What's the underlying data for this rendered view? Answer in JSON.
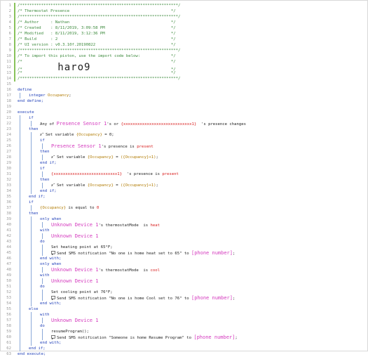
{
  "code_lines": [
    {
      "n": "1",
      "d": 0,
      "bar": true,
      "s": [
        {
          "t": "/*******************************************************************/",
          "c": "cm"
        }
      ]
    },
    {
      "n": "2",
      "d": 0,
      "bar": true,
      "s": [
        {
          "t": "/* Thermostat Presence                                           */",
          "c": "cm"
        }
      ]
    },
    {
      "n": "3",
      "d": 0,
      "bar": true,
      "s": [
        {
          "t": "/*******************************************************************/",
          "c": "cm"
        }
      ]
    },
    {
      "n": "4",
      "d": 0,
      "bar": true,
      "s": [
        {
          "t": "/* Author     : Nathan                                           */",
          "c": "cm"
        }
      ]
    },
    {
      "n": "5",
      "d": 0,
      "bar": true,
      "s": [
        {
          "t": "/* Created    : 8/11/2019, 3:09:58 PM                            */",
          "c": "cm"
        }
      ]
    },
    {
      "n": "6",
      "d": 0,
      "bar": true,
      "s": [
        {
          "t": "/* Modified   : 8/11/2019, 3:12:36 PM                            */",
          "c": "cm"
        }
      ]
    },
    {
      "n": "7",
      "d": 0,
      "bar": true,
      "s": [
        {
          "t": "/* Build      : 2                                                */",
          "c": "cm"
        }
      ]
    },
    {
      "n": "8",
      "d": 0,
      "bar": true,
      "s": [
        {
          "t": "/* UI version : v0.3.10f.20190822                                */",
          "c": "cm"
        }
      ]
    },
    {
      "n": "9",
      "d": 0,
      "bar": true,
      "s": [
        {
          "t": "/*******************************************************************/",
          "c": "cm"
        }
      ]
    },
    {
      "n": "10",
      "d": 0,
      "bar": true,
      "s": [
        {
          "t": "/* To import this piston, use the import code below:             */",
          "c": "cm"
        }
      ]
    },
    {
      "n": "11",
      "d": 0,
      "bar": true,
      "s": [
        {
          "t": "/*                                                               */",
          "c": "cm"
        }
      ]
    },
    {
      "n": "12",
      "d": 0,
      "bar": true,
      "s": [
        {
          "t": "/*",
          "c": "cm"
        },
        {
          "t": "               ",
          "c": "plain"
        },
        {
          "t": "haro9",
          "c": "big"
        },
        {
          "t": "                                  */",
          "c": "cm"
        }
      ]
    },
    {
      "n": "13",
      "d": 0,
      "bar": true,
      "s": [
        {
          "t": "/*                                                               */",
          "c": "cm"
        }
      ]
    },
    {
      "n": "14",
      "d": 0,
      "bar": true,
      "s": [
        {
          "t": "/*******************************************************************/",
          "c": "cm"
        }
      ]
    },
    {
      "n": "15",
      "d": 0,
      "bar": false,
      "s": []
    },
    {
      "n": "16",
      "d": 0,
      "bar": false,
      "s": [
        {
          "t": "define",
          "c": "kw"
        }
      ]
    },
    {
      "n": "17",
      "d": 1,
      "bar": false,
      "s": [
        {
          "t": "integer ",
          "c": "kw"
        },
        {
          "t": "Occupancy",
          "c": "var"
        },
        {
          "t": ";",
          "c": "plain"
        }
      ]
    },
    {
      "n": "18",
      "d": 0,
      "bar": false,
      "s": [
        {
          "t": "end define;",
          "c": "kw"
        }
      ]
    },
    {
      "n": "19",
      "d": 0,
      "bar": false,
      "s": []
    },
    {
      "n": "20",
      "d": 0,
      "bar": false,
      "s": [
        {
          "t": "execute",
          "c": "kw"
        }
      ]
    },
    {
      "n": "21",
      "d": 1,
      "bar": false,
      "s": [
        {
          "t": "if",
          "c": "kw"
        }
      ]
    },
    {
      "n": "22",
      "d": 2,
      "bar": false,
      "s": [
        {
          "t": "Any of ",
          "c": "plain"
        },
        {
          "t": "Presence Sensor 1",
          "c": "dev"
        },
        {
          "t": "'s or ",
          "c": "plain"
        },
        {
          "t": "{xxxxxxxxxxxxxxxxxxxxxxxxxxxxx1}",
          "c": "red"
        },
        {
          "t": "  's presence changes",
          "c": "plain"
        }
      ]
    },
    {
      "n": "23",
      "d": 1,
      "bar": false,
      "s": [
        {
          "t": "then",
          "c": "kw"
        }
      ]
    },
    {
      "n": "24",
      "d": 2,
      "bar": false,
      "s": [
        {
          "t": "Set variable ",
          "c": "plain",
          "icon": "set"
        },
        {
          "t": "{Occupancy}",
          "c": "var"
        },
        {
          "t": " = 0;",
          "c": "plain"
        }
      ]
    },
    {
      "n": "25",
      "d": 2,
      "bar": false,
      "s": [
        {
          "t": "if",
          "c": "kw"
        }
      ]
    },
    {
      "n": "26",
      "d": 3,
      "bar": false,
      "s": [
        {
          "t": "Presence Sensor 1",
          "c": "dev"
        },
        {
          "t": "'s presence is ",
          "c": "plain"
        },
        {
          "t": "present",
          "c": "red"
        }
      ]
    },
    {
      "n": "27",
      "d": 2,
      "bar": false,
      "s": [
        {
          "t": "then",
          "c": "kw"
        }
      ]
    },
    {
      "n": "28",
      "d": 3,
      "bar": false,
      "s": [
        {
          "t": "Set variable ",
          "c": "plain",
          "icon": "set"
        },
        {
          "t": "{Occupancy}",
          "c": "var"
        },
        {
          "t": " = ",
          "c": "plain"
        },
        {
          "t": "({Occupancy}+1)",
          "c": "var"
        },
        {
          "t": ";",
          "c": "plain"
        }
      ]
    },
    {
      "n": "29",
      "d": 2,
      "bar": false,
      "s": [
        {
          "t": "end if;",
          "c": "kw"
        }
      ]
    },
    {
      "n": "30",
      "d": 2,
      "bar": false,
      "s": [
        {
          "t": "if",
          "c": "kw"
        }
      ]
    },
    {
      "n": "31",
      "d": 3,
      "bar": false,
      "s": [
        {
          "t": "{xxxxxxxxxxxxxxxxxxxxxxxxxxx1}",
          "c": "red"
        },
        {
          "t": "  's presence is ",
          "c": "plain"
        },
        {
          "t": "present",
          "c": "red"
        }
      ]
    },
    {
      "n": "32",
      "d": 2,
      "bar": false,
      "s": [
        {
          "t": "then",
          "c": "kw"
        }
      ]
    },
    {
      "n": "33",
      "d": 3,
      "bar": false,
      "s": [
        {
          "t": "Set variable ",
          "c": "plain",
          "icon": "set"
        },
        {
          "t": "{Occupancy}",
          "c": "var"
        },
        {
          "t": " = ",
          "c": "plain"
        },
        {
          "t": "({Occupancy}+1)",
          "c": "var"
        },
        {
          "t": ";",
          "c": "plain"
        }
      ]
    },
    {
      "n": "34",
      "d": 2,
      "bar": false,
      "s": [
        {
          "t": "end if;",
          "c": "kw"
        }
      ]
    },
    {
      "n": "35",
      "d": 1,
      "bar": false,
      "s": [
        {
          "t": "end if;",
          "c": "kw"
        }
      ]
    },
    {
      "n": "36",
      "d": 1,
      "bar": false,
      "s": [
        {
          "t": "if",
          "c": "kw"
        }
      ]
    },
    {
      "n": "37",
      "d": 2,
      "bar": false,
      "s": [
        {
          "t": "{Occupancy}",
          "c": "var"
        },
        {
          "t": " is equal to ",
          "c": "plain"
        },
        {
          "t": "0",
          "c": "red"
        }
      ]
    },
    {
      "n": "38",
      "d": 1,
      "bar": false,
      "s": [
        {
          "t": "then",
          "c": "kw"
        }
      ]
    },
    {
      "n": "39",
      "d": 2,
      "bar": false,
      "s": [
        {
          "t": "only when",
          "c": "kw"
        }
      ]
    },
    {
      "n": "40",
      "d": 3,
      "bar": false,
      "s": [
        {
          "t": "Unknown Device 1",
          "c": "dev"
        },
        {
          "t": "'s thermostatMode  is ",
          "c": "plain"
        },
        {
          "t": "heat",
          "c": "red"
        }
      ]
    },
    {
      "n": "41",
      "d": 2,
      "bar": false,
      "s": [
        {
          "t": "with",
          "c": "kw"
        }
      ]
    },
    {
      "n": "42",
      "d": 3,
      "bar": false,
      "s": [
        {
          "t": "Unknown Device 1",
          "c": "dev"
        }
      ]
    },
    {
      "n": "43",
      "d": 2,
      "bar": false,
      "s": [
        {
          "t": "do",
          "c": "kw"
        }
      ]
    },
    {
      "n": "44",
      "d": 3,
      "bar": false,
      "s": [
        {
          "t": "Set heating point at 65°F;",
          "c": "plain"
        }
      ]
    },
    {
      "n": "45",
      "d": 3,
      "bar": false,
      "s": [
        {
          "t": "Send SMS notification ",
          "c": "plain",
          "icon": "msg"
        },
        {
          "t": "\"No one is home heat set to 65\"",
          "c": "plain"
        },
        {
          "t": " to ",
          "c": "plain"
        },
        {
          "t": "[phone number]",
          "c": "dev"
        },
        {
          "t": ";",
          "c": "plain"
        }
      ]
    },
    {
      "n": "46",
      "d": 2,
      "bar": false,
      "s": [
        {
          "t": "end with;",
          "c": "kw"
        }
      ]
    },
    {
      "n": "47",
      "d": 2,
      "bar": false,
      "s": [
        {
          "t": "only when",
          "c": "kw"
        }
      ]
    },
    {
      "n": "48",
      "d": 3,
      "bar": false,
      "s": [
        {
          "t": "Unknown Device 1",
          "c": "dev"
        },
        {
          "t": "'s thermostatMode  is ",
          "c": "plain"
        },
        {
          "t": "cool",
          "c": "red"
        }
      ]
    },
    {
      "n": "49",
      "d": 2,
      "bar": false,
      "s": [
        {
          "t": "with",
          "c": "kw"
        }
      ]
    },
    {
      "n": "50",
      "d": 3,
      "bar": false,
      "s": [
        {
          "t": "Unknown Device 1",
          "c": "dev"
        }
      ]
    },
    {
      "n": "51",
      "d": 2,
      "bar": false,
      "s": [
        {
          "t": "do",
          "c": "kw"
        }
      ]
    },
    {
      "n": "52",
      "d": 3,
      "bar": false,
      "s": [
        {
          "t": "Set cooling point at 76°F;",
          "c": "plain"
        }
      ]
    },
    {
      "n": "53",
      "d": 3,
      "bar": false,
      "s": [
        {
          "t": "Send SMS notification ",
          "c": "plain",
          "icon": "msg"
        },
        {
          "t": "\"No one is home Cool set to 76\"",
          "c": "plain"
        },
        {
          "t": " to ",
          "c": "plain"
        },
        {
          "t": "[phone number]",
          "c": "dev"
        },
        {
          "t": ";",
          "c": "plain"
        }
      ]
    },
    {
      "n": "54",
      "d": 2,
      "bar": false,
      "s": [
        {
          "t": "end with;",
          "c": "kw"
        }
      ]
    },
    {
      "n": "55",
      "d": 1,
      "bar": false,
      "s": [
        {
          "t": "else",
          "c": "kw"
        }
      ]
    },
    {
      "n": "56",
      "d": 2,
      "bar": false,
      "s": [
        {
          "t": "with",
          "c": "kw"
        }
      ]
    },
    {
      "n": "57",
      "d": 3,
      "bar": false,
      "s": [
        {
          "t": "Unknown Device 1",
          "c": "dev"
        }
      ]
    },
    {
      "n": "58",
      "d": 2,
      "bar": false,
      "s": [
        {
          "t": "do",
          "c": "kw"
        }
      ]
    },
    {
      "n": "59",
      "d": 3,
      "bar": false,
      "s": [
        {
          "t": "resumeProgram();",
          "c": "plain"
        }
      ]
    },
    {
      "n": "60",
      "d": 3,
      "bar": false,
      "s": [
        {
          "t": "Send SMS notification ",
          "c": "plain",
          "icon": "msg"
        },
        {
          "t": "\"Someone is home Resume Program\"",
          "c": "plain"
        },
        {
          "t": " to ",
          "c": "plain"
        },
        {
          "t": "[phone number]",
          "c": "dev"
        },
        {
          "t": ";",
          "c": "plain"
        }
      ]
    },
    {
      "n": "61",
      "d": 2,
      "bar": false,
      "s": [
        {
          "t": "end with;",
          "c": "kw"
        }
      ]
    },
    {
      "n": "62",
      "d": 1,
      "bar": false,
      "s": [
        {
          "t": "end if;",
          "c": "kw"
        }
      ]
    },
    {
      "n": "63",
      "d": 0,
      "bar": false,
      "s": [
        {
          "t": "end execute;",
          "c": "kw"
        }
      ]
    }
  ],
  "icons": {
    "set": "variable-assign-icon",
    "msg": "message-icon"
  },
  "colors": {
    "comment": "#3c8a3c",
    "keyword": "#1f3fb8",
    "variable": "#b07a00",
    "device": "#d43abe",
    "value": "#d81b1b",
    "gutter_bar": "#88c25a",
    "indent_guide": "#8aa8d8"
  }
}
